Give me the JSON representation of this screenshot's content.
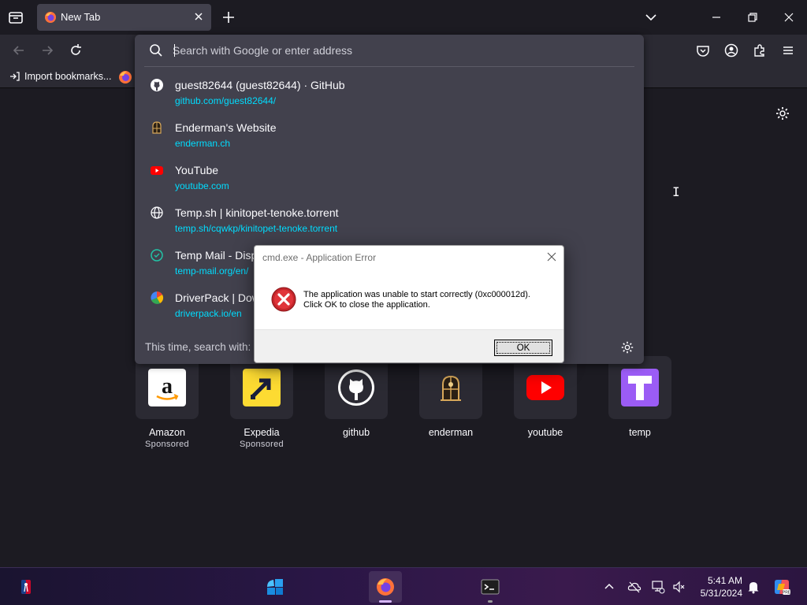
{
  "tabs": [
    {
      "title": "New Tab",
      "active": true
    }
  ],
  "urlbar": {
    "placeholder": "Search with Google or enter address",
    "results": [
      {
        "title": "guest82644 (guest82644) · GitHub",
        "url": "github.com/guest82644/",
        "icon": "github-icon"
      },
      {
        "title": "Enderman's Website",
        "url": "enderman.ch",
        "icon": "enderman-icon"
      },
      {
        "title": "YouTube",
        "url": "youtube.com",
        "icon": "youtube-icon"
      },
      {
        "title": "Temp.sh | kinitopet-tenoke.torrent",
        "url": "temp.sh/cqwkp/kinitopet-tenoke.torrent",
        "icon": "globe-icon"
      },
      {
        "title": "Temp Mail - Disp",
        "url": "temp-mail.org/en/",
        "icon": "tempmail-icon"
      },
      {
        "title": "DriverPack | Dow",
        "url": "driverpack.io/en",
        "icon": "driverpack-icon"
      }
    ],
    "oneoff_label": "This time, search with:"
  },
  "bookmarks": {
    "import_label": "Import bookmarks..."
  },
  "top_sites": [
    {
      "label": "Amazon",
      "sub": "Sponsored",
      "icon": "amazon-icon"
    },
    {
      "label": "Expedia",
      "sub": "Sponsored",
      "icon": "expedia-icon"
    },
    {
      "label": "github",
      "sub": "",
      "icon": "github-icon"
    },
    {
      "label": "enderman",
      "sub": "",
      "icon": "enderman-icon"
    },
    {
      "label": "youtube",
      "sub": "",
      "icon": "youtube-icon"
    },
    {
      "label": "temp",
      "sub": "",
      "icon": "temp-icon"
    }
  ],
  "dialog": {
    "title": "cmd.exe - Application Error",
    "message_line1": "The application was unable to start correctly (0xc000012d).",
    "message_line2": "Click OK to close the application.",
    "ok_label": "OK"
  },
  "taskbar": {
    "time": "5:41 AM",
    "date": "5/31/2024"
  },
  "colors": {
    "accent": "#00ddff",
    "browser_bg": "#1c1b22",
    "toolbar_bg": "#2b2a33",
    "panel_bg": "#42414d"
  }
}
